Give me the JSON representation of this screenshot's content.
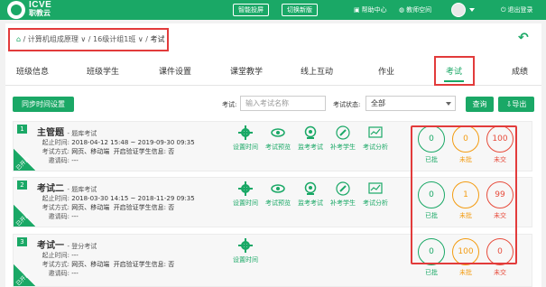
{
  "header": {
    "logo_top": "ICVE",
    "logo_bottom": "职教云",
    "btn_screen": "智能投屏",
    "btn_switch": "切换新版",
    "help": "帮助中心",
    "space": "教师空间",
    "logout": "退出登录"
  },
  "breadcrumb": {
    "course": "计算机组成原理",
    "klass": "16级计组1班",
    "current": "考试"
  },
  "tabs": [
    "班级信息",
    "班级学生",
    "课件设置",
    "课堂教学",
    "线上互动",
    "作业",
    "考试",
    "成绩"
  ],
  "toolbar": {
    "sync": "同步时间设置",
    "exam_label": "考试:",
    "exam_placeholder": "输入考试名称",
    "status_label": "考试状态:",
    "status_value": "全部",
    "query": "查询",
    "export": "导出"
  },
  "labels": {
    "start": "起止时间:",
    "mode": "考试方式:",
    "verify": "开启验证学生信息:",
    "invite": "邀请码:",
    "ribbon": "已开启"
  },
  "actions": {
    "settime": "设置时间",
    "preview": "考试预览",
    "monitor": "监考考试",
    "makeup": "补考学生",
    "analysis": "考试分析"
  },
  "stat_labels": {
    "done": "已批",
    "pending": "未批",
    "not_submitted": "未交"
  },
  "exams": [
    {
      "num": "1",
      "title": "主管题",
      "type": "- 题库考试",
      "time": "2018-04-12 15:48 ~ 2019-09-30 09:35",
      "mode": "网页、移动端",
      "verify": "否",
      "invite": "---",
      "done": "0",
      "pending": "0",
      "not_submitted": "100"
    },
    {
      "num": "2",
      "title": "考试二",
      "type": "- 题库考试",
      "time": "2018-03-30 14:15 ~ 2018-11-29 09:35",
      "mode": "网页、移动端",
      "verify": "否",
      "invite": "---",
      "done": "0",
      "pending": "1",
      "not_submitted": "99"
    },
    {
      "num": "3",
      "title": "考试一",
      "type": "- 登分考试",
      "time": "---",
      "mode": "网页、移动端",
      "verify": "否",
      "invite": "---",
      "done": "0",
      "pending": "100",
      "not_submitted": "0"
    }
  ],
  "colors": {
    "brand": "#1aa866",
    "highlight_box": "#e23b3b",
    "pending": "#f39c12",
    "not_submitted": "#e74c3c"
  }
}
